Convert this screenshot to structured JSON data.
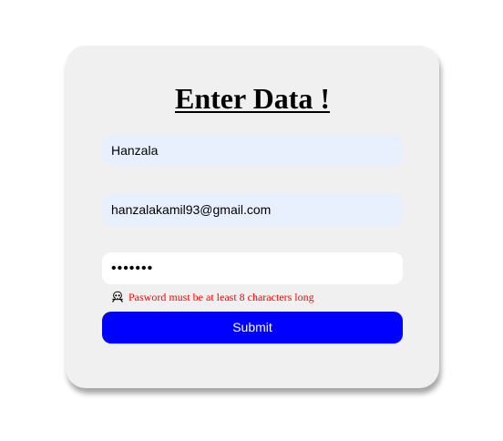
{
  "form": {
    "title": "Enter Data !",
    "name_value": "Hanzala",
    "email_value": "hanzalakamil93@gmail.com",
    "password_value": "•••••••",
    "error_icon": "skull-crossbones-icon",
    "error_message": "Pasword must be at least 8 characters long",
    "submit_label": "Submit"
  },
  "colors": {
    "card_background": "#f0f0f0",
    "autofill_background": "#e8f0fe",
    "error_text": "#ff0000",
    "submit_background": "#0000ff",
    "submit_text": "#ffffff"
  }
}
